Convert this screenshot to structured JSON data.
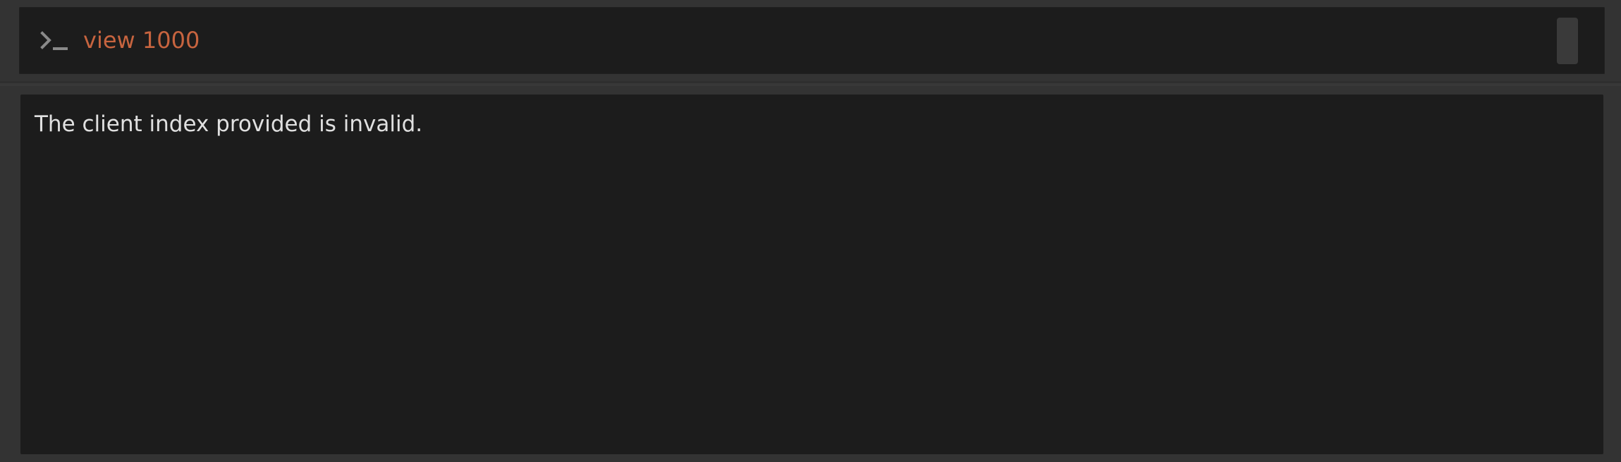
{
  "command_box": {
    "prompt_icon": "terminal-prompt-icon",
    "text": "view 1000",
    "text_color": "#c7643f"
  },
  "result_box": {
    "text": "The client index provided is invalid.",
    "text_color": "#e0e0e0"
  },
  "colors": {
    "background": "#383838",
    "panel": "#333333",
    "box": "#1c1c1c"
  }
}
